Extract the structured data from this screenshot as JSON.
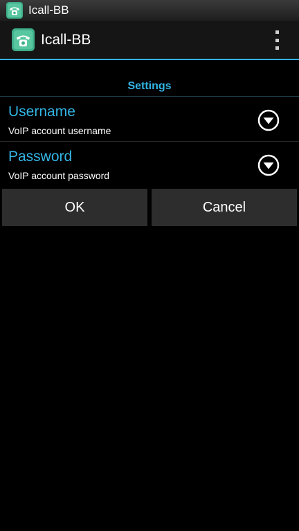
{
  "status_bar": {
    "title": "Icall-BB",
    "icon": "phone-app-icon"
  },
  "action_bar": {
    "title": "Icall-BB",
    "icon": "phone-app-icon",
    "overflow_icon": "overflow-menu-icon"
  },
  "settings": {
    "header": "Settings",
    "items": [
      {
        "title": "Username",
        "summary": "VoIP account username",
        "icon": "dropdown-circle-icon"
      },
      {
        "title": "Password",
        "summary": "VoIP account password",
        "icon": "dropdown-circle-icon"
      }
    ]
  },
  "buttons": {
    "ok_label": "OK",
    "cancel_label": "Cancel"
  },
  "colors": {
    "accent": "#33b5e5",
    "background": "#000000",
    "button": "#2d2d2d",
    "app_icon_green": "#3fae8a"
  }
}
